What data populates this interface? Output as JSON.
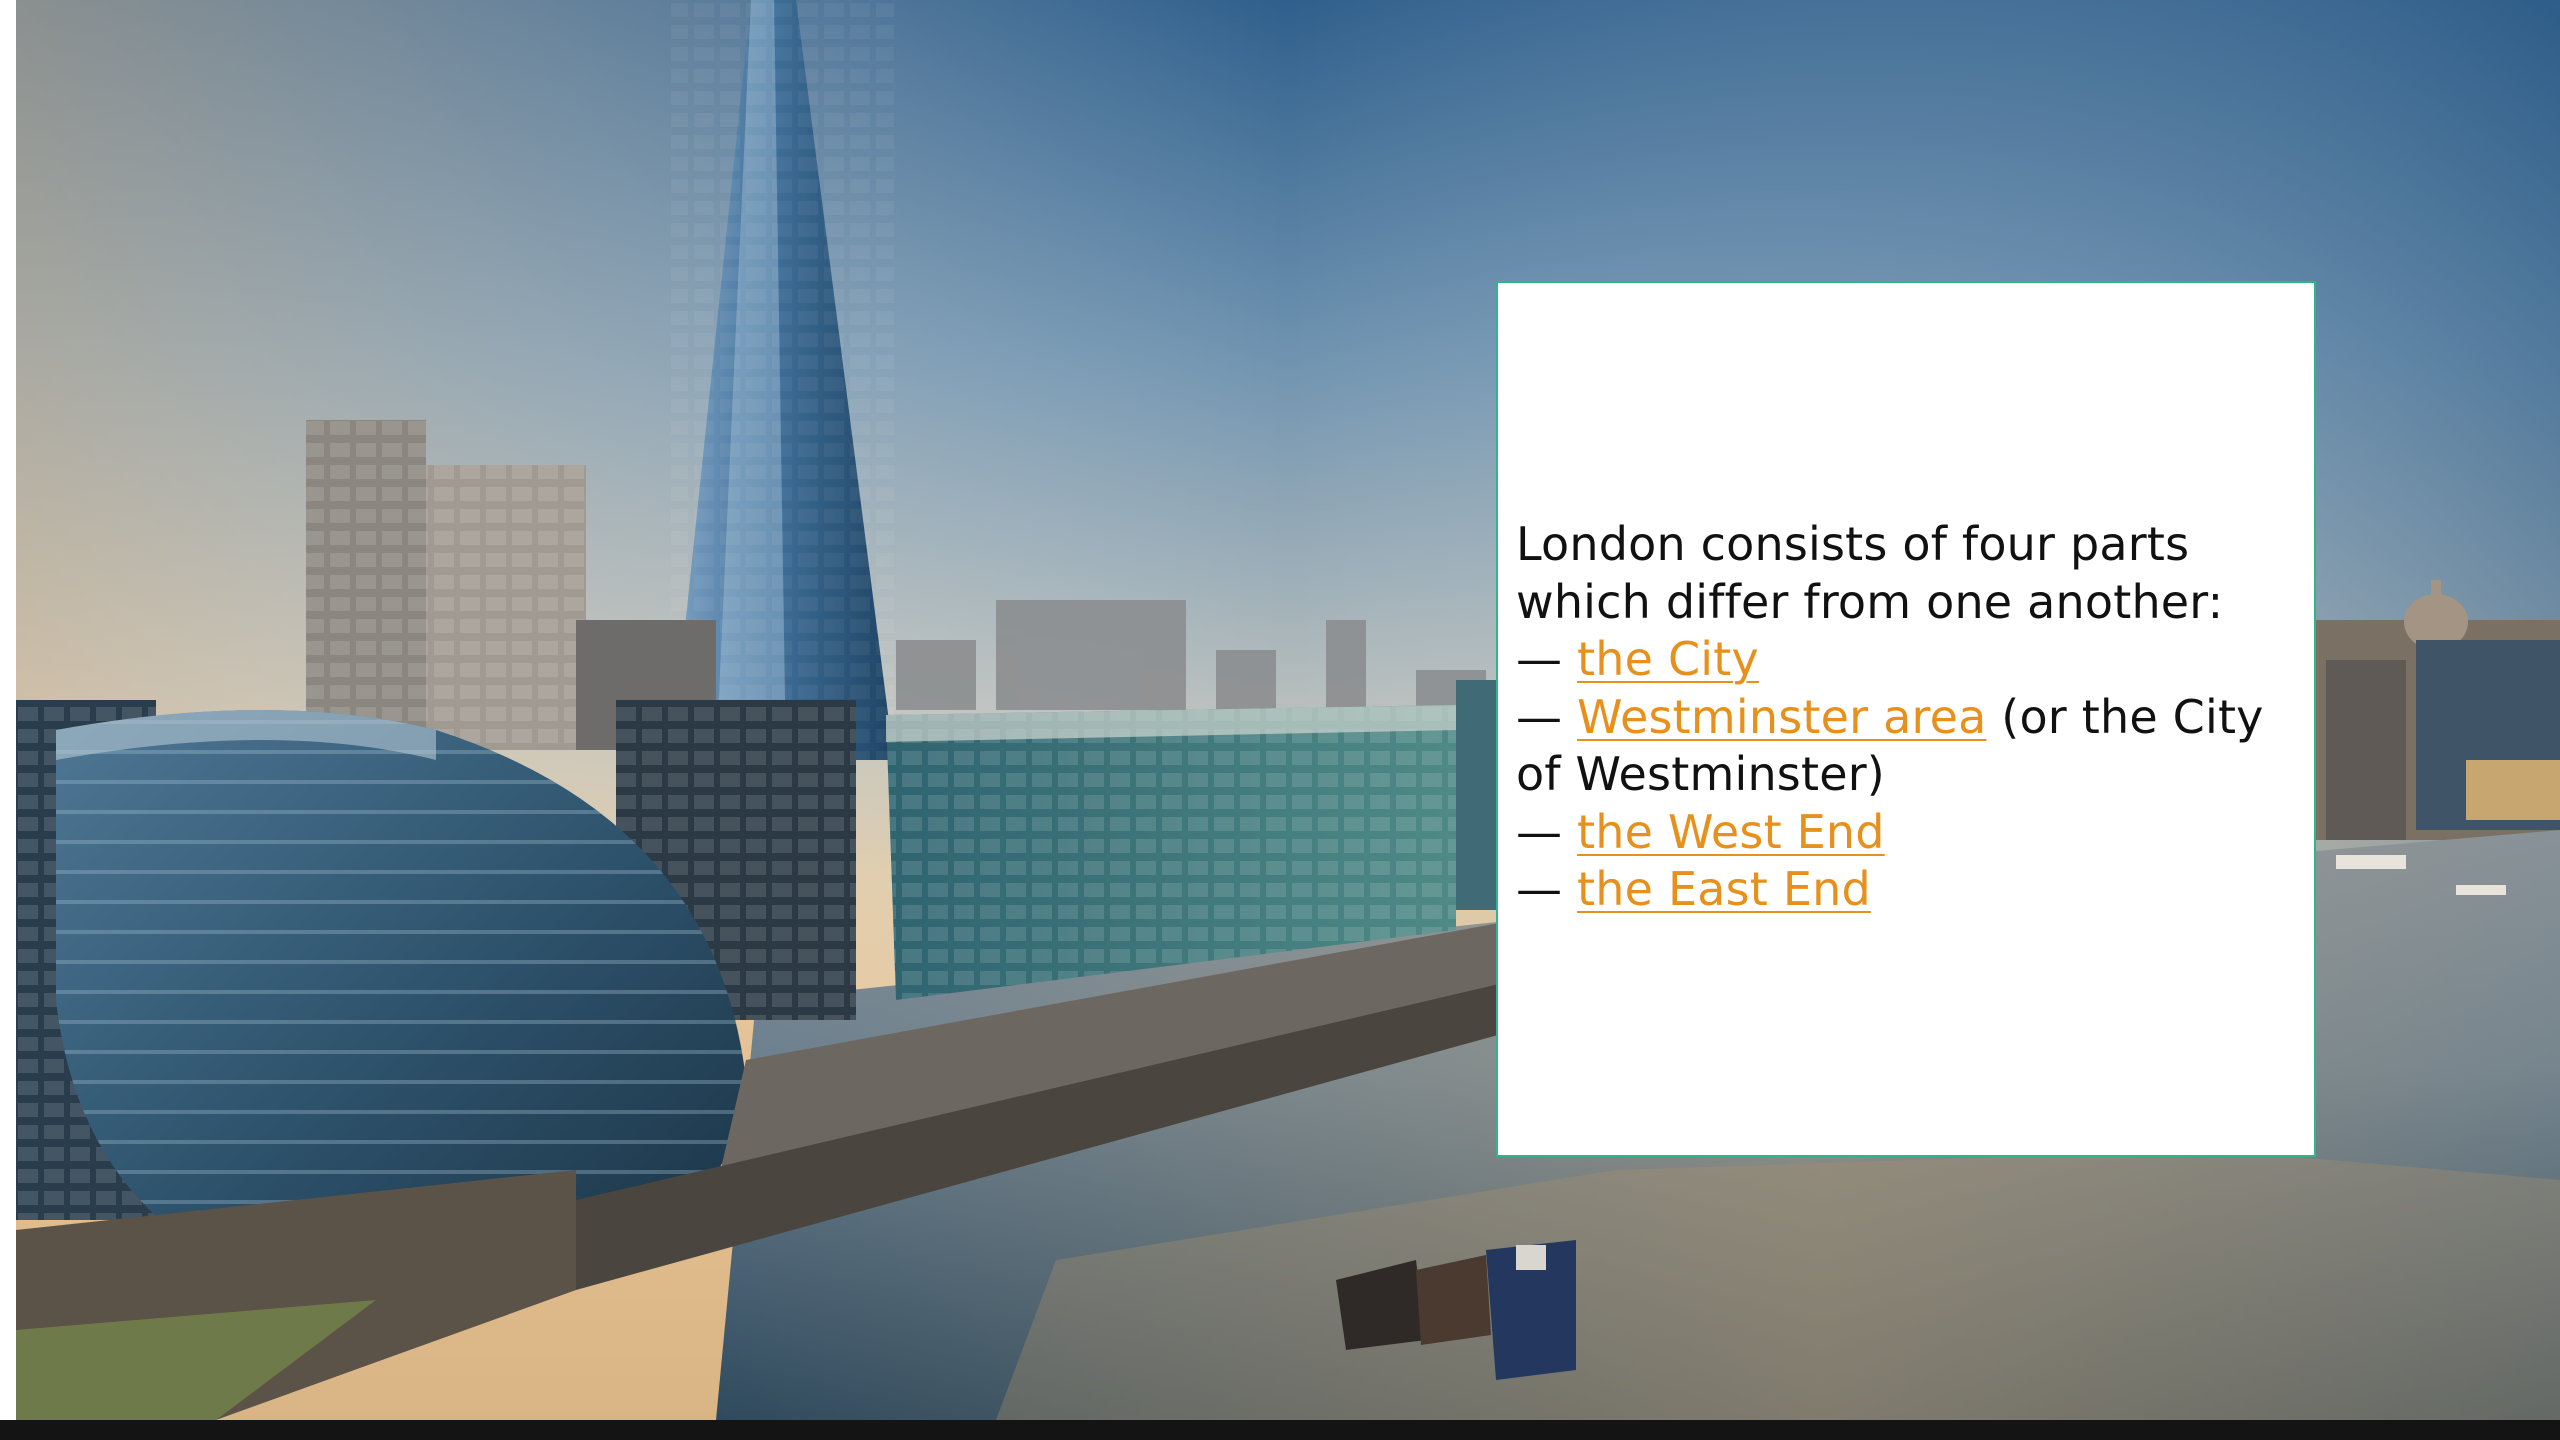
{
  "slide": {
    "intro_line1": "London consists of four parts",
    "intro_line2": "which differ from one another:",
    "dash": "—",
    "item1_link": "the City",
    "item2_link": "Westminster area",
    "item2_suffix": " (or the City",
    "item2_line2": "of Westminster)",
    "item3_link": "the West End",
    "item4_link": "the East End"
  },
  "colors": {
    "link": "#e8901c",
    "box_border": "#2fb58c",
    "text": "#111111"
  },
  "icons": {
    "background": "london-skyline-photo"
  }
}
